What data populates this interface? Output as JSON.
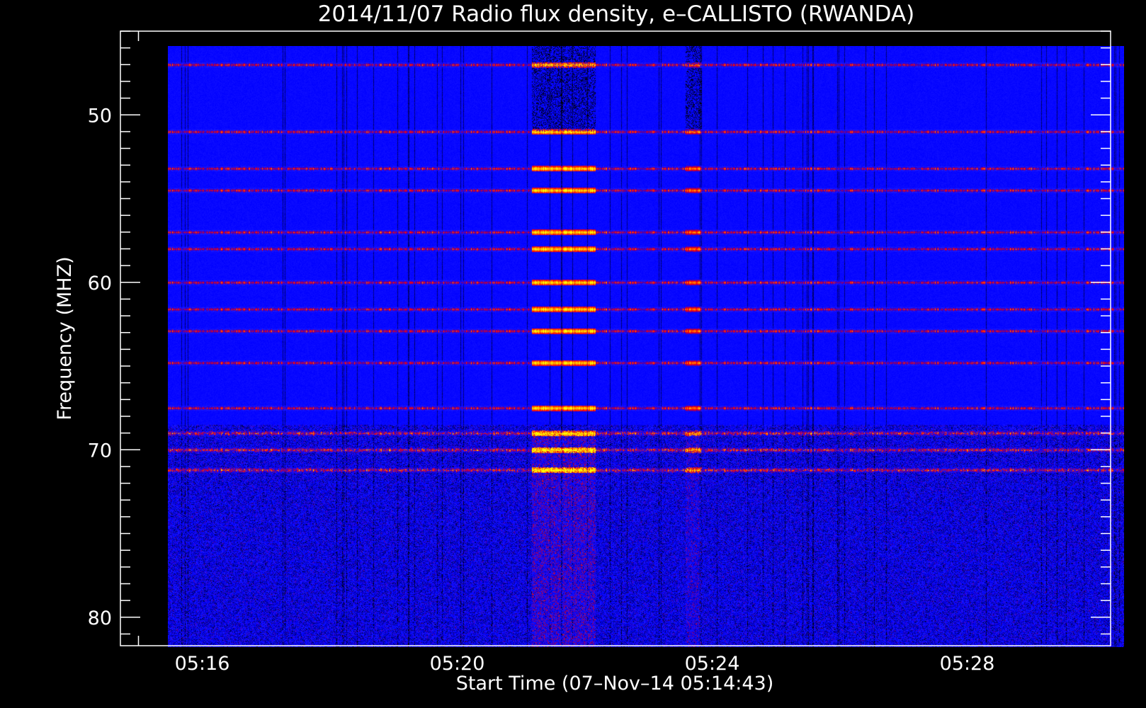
{
  "chart_data": {
    "type": "heatmap",
    "title": "2014/11/07  Radio flux density, e–CALLISTO (RWANDA)",
    "xlabel": "Start Time (07–Nov–14 05:14:43)",
    "ylabel": "Frequency (MHZ)",
    "x_axis": {
      "unit": "minutes_of_day",
      "range": [
        "05:14:43",
        "05:30:15"
      ],
      "major_ticks": [
        "05:16",
        "05:20",
        "05:24",
        "05:28"
      ],
      "minor_tick_step_minutes": 1
    },
    "y_axis": {
      "inverted": true,
      "range": [
        45,
        81.7
      ],
      "major_ticks": [
        50,
        60,
        70,
        80
      ],
      "minor_tick_step": 1
    },
    "data_extent": {
      "time_start": "05:15:28",
      "time_end": "05:30:28",
      "freq_min": 45.9,
      "freq_max": 81.8
    },
    "colormap": [
      "#000000",
      "#0000ff",
      "#ff0000",
      "#ffff00"
    ],
    "background_color": "#2020ff",
    "bright_frequency_bands_mhz": [
      47.0,
      51.0,
      53.2,
      54.5,
      57.0,
      58.0,
      60.0,
      61.6,
      62.9,
      64.8,
      67.5,
      69.0,
      70.0,
      71.2
    ],
    "burst_intervals": [
      {
        "start": "05:21:10",
        "end": "05:22:10",
        "intensity": 1.0
      },
      {
        "start": "05:23:35",
        "end": "05:23:50",
        "intensity": 0.6
      }
    ]
  }
}
